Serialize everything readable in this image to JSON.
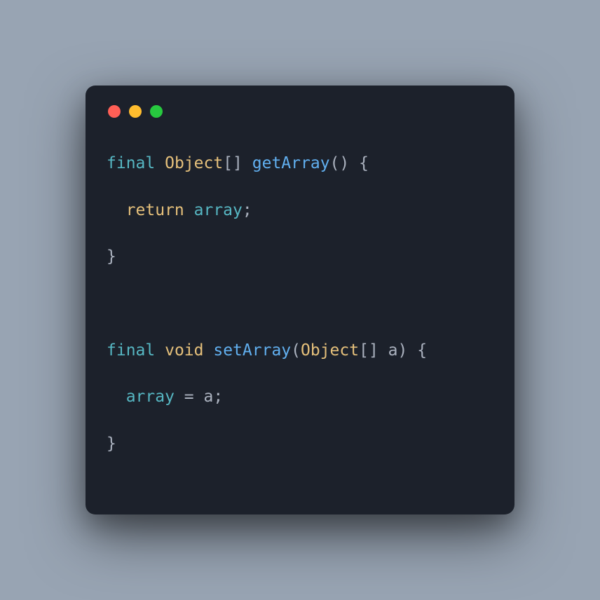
{
  "code": {
    "line1": {
      "final": "final",
      "type": "Object",
      "brackets": "[]",
      "fn": "getArray",
      "parens": "()",
      "space": " ",
      "brace": "{"
    },
    "line2": {
      "return": "return",
      "var": "array",
      "semi": ";"
    },
    "line3": {
      "brace": "}"
    },
    "line4": {
      "final": "final",
      "void": "void",
      "fn": "setArray",
      "paren_open": "(",
      "param_type": "Object",
      "brackets": "[]",
      "param_name": "a",
      "paren_close": ")",
      "brace": "{"
    },
    "line5": {
      "var": "array",
      "eq": " = ",
      "val": "a",
      "semi": ";"
    },
    "line6": {
      "brace": "}"
    }
  }
}
